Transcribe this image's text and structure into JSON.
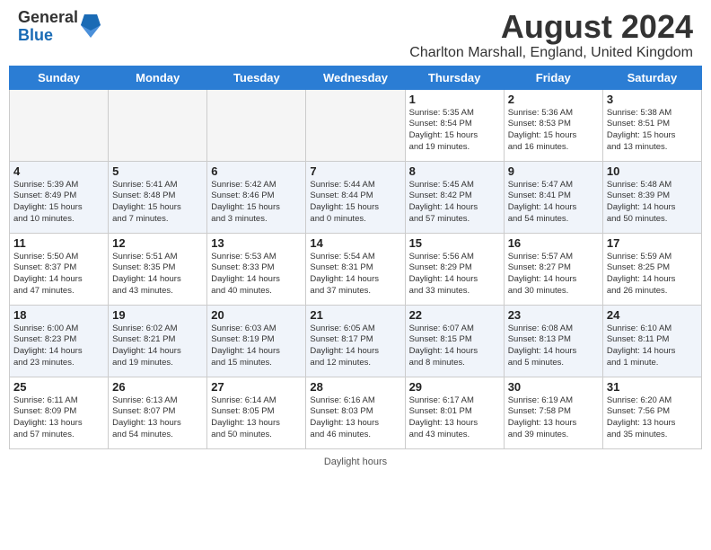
{
  "header": {
    "logo_general": "General",
    "logo_blue": "Blue",
    "month_title": "August 2024",
    "location": "Charlton Marshall, England, United Kingdom"
  },
  "days_of_week": [
    "Sunday",
    "Monday",
    "Tuesday",
    "Wednesday",
    "Thursday",
    "Friday",
    "Saturday"
  ],
  "footer": {
    "note": "Daylight hours"
  },
  "weeks": [
    {
      "alt": false,
      "days": [
        {
          "num": "",
          "info": ""
        },
        {
          "num": "",
          "info": ""
        },
        {
          "num": "",
          "info": ""
        },
        {
          "num": "",
          "info": ""
        },
        {
          "num": "1",
          "info": "Sunrise: 5:35 AM\nSunset: 8:54 PM\nDaylight: 15 hours\nand 19 minutes."
        },
        {
          "num": "2",
          "info": "Sunrise: 5:36 AM\nSunset: 8:53 PM\nDaylight: 15 hours\nand 16 minutes."
        },
        {
          "num": "3",
          "info": "Sunrise: 5:38 AM\nSunset: 8:51 PM\nDaylight: 15 hours\nand 13 minutes."
        }
      ]
    },
    {
      "alt": true,
      "days": [
        {
          "num": "4",
          "info": "Sunrise: 5:39 AM\nSunset: 8:49 PM\nDaylight: 15 hours\nand 10 minutes."
        },
        {
          "num": "5",
          "info": "Sunrise: 5:41 AM\nSunset: 8:48 PM\nDaylight: 15 hours\nand 7 minutes."
        },
        {
          "num": "6",
          "info": "Sunrise: 5:42 AM\nSunset: 8:46 PM\nDaylight: 15 hours\nand 3 minutes."
        },
        {
          "num": "7",
          "info": "Sunrise: 5:44 AM\nSunset: 8:44 PM\nDaylight: 15 hours\nand 0 minutes."
        },
        {
          "num": "8",
          "info": "Sunrise: 5:45 AM\nSunset: 8:42 PM\nDaylight: 14 hours\nand 57 minutes."
        },
        {
          "num": "9",
          "info": "Sunrise: 5:47 AM\nSunset: 8:41 PM\nDaylight: 14 hours\nand 54 minutes."
        },
        {
          "num": "10",
          "info": "Sunrise: 5:48 AM\nSunset: 8:39 PM\nDaylight: 14 hours\nand 50 minutes."
        }
      ]
    },
    {
      "alt": false,
      "days": [
        {
          "num": "11",
          "info": "Sunrise: 5:50 AM\nSunset: 8:37 PM\nDaylight: 14 hours\nand 47 minutes."
        },
        {
          "num": "12",
          "info": "Sunrise: 5:51 AM\nSunset: 8:35 PM\nDaylight: 14 hours\nand 43 minutes."
        },
        {
          "num": "13",
          "info": "Sunrise: 5:53 AM\nSunset: 8:33 PM\nDaylight: 14 hours\nand 40 minutes."
        },
        {
          "num": "14",
          "info": "Sunrise: 5:54 AM\nSunset: 8:31 PM\nDaylight: 14 hours\nand 37 minutes."
        },
        {
          "num": "15",
          "info": "Sunrise: 5:56 AM\nSunset: 8:29 PM\nDaylight: 14 hours\nand 33 minutes."
        },
        {
          "num": "16",
          "info": "Sunrise: 5:57 AM\nSunset: 8:27 PM\nDaylight: 14 hours\nand 30 minutes."
        },
        {
          "num": "17",
          "info": "Sunrise: 5:59 AM\nSunset: 8:25 PM\nDaylight: 14 hours\nand 26 minutes."
        }
      ]
    },
    {
      "alt": true,
      "days": [
        {
          "num": "18",
          "info": "Sunrise: 6:00 AM\nSunset: 8:23 PM\nDaylight: 14 hours\nand 23 minutes."
        },
        {
          "num": "19",
          "info": "Sunrise: 6:02 AM\nSunset: 8:21 PM\nDaylight: 14 hours\nand 19 minutes."
        },
        {
          "num": "20",
          "info": "Sunrise: 6:03 AM\nSunset: 8:19 PM\nDaylight: 14 hours\nand 15 minutes."
        },
        {
          "num": "21",
          "info": "Sunrise: 6:05 AM\nSunset: 8:17 PM\nDaylight: 14 hours\nand 12 minutes."
        },
        {
          "num": "22",
          "info": "Sunrise: 6:07 AM\nSunset: 8:15 PM\nDaylight: 14 hours\nand 8 minutes."
        },
        {
          "num": "23",
          "info": "Sunrise: 6:08 AM\nSunset: 8:13 PM\nDaylight: 14 hours\nand 5 minutes."
        },
        {
          "num": "24",
          "info": "Sunrise: 6:10 AM\nSunset: 8:11 PM\nDaylight: 14 hours\nand 1 minute."
        }
      ]
    },
    {
      "alt": false,
      "days": [
        {
          "num": "25",
          "info": "Sunrise: 6:11 AM\nSunset: 8:09 PM\nDaylight: 13 hours\nand 57 minutes."
        },
        {
          "num": "26",
          "info": "Sunrise: 6:13 AM\nSunset: 8:07 PM\nDaylight: 13 hours\nand 54 minutes."
        },
        {
          "num": "27",
          "info": "Sunrise: 6:14 AM\nSunset: 8:05 PM\nDaylight: 13 hours\nand 50 minutes."
        },
        {
          "num": "28",
          "info": "Sunrise: 6:16 AM\nSunset: 8:03 PM\nDaylight: 13 hours\nand 46 minutes."
        },
        {
          "num": "29",
          "info": "Sunrise: 6:17 AM\nSunset: 8:01 PM\nDaylight: 13 hours\nand 43 minutes."
        },
        {
          "num": "30",
          "info": "Sunrise: 6:19 AM\nSunset: 7:58 PM\nDaylight: 13 hours\nand 39 minutes."
        },
        {
          "num": "31",
          "info": "Sunrise: 6:20 AM\nSunset: 7:56 PM\nDaylight: 13 hours\nand 35 minutes."
        }
      ]
    }
  ]
}
